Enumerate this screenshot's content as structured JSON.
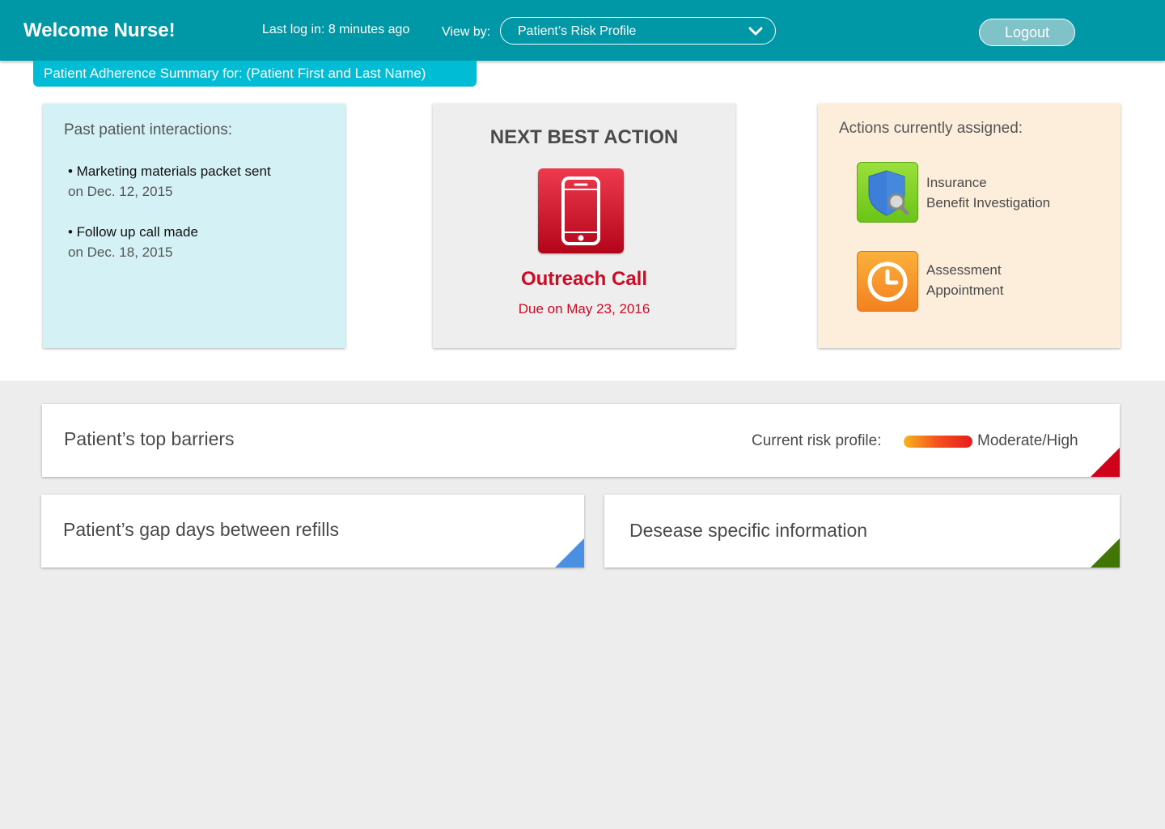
{
  "header": {
    "welcome": "Welcome Nurse!",
    "last_login": "Last log in: 8 minutes ago",
    "view_by_label": "View by:",
    "view_by_value": "Patient’s Risk Profile",
    "logout_label": "Logout"
  },
  "summary": {
    "title": "Patient Adherence Summary for: (Patient First and Last Name)"
  },
  "past_interactions": {
    "heading": "Past patient interactions:",
    "items": [
      {
        "what": "• Marketing materials packet sent",
        "when": "on Dec. 12, 2015"
      },
      {
        "what": "• Follow up call made",
        "when": "on Dec. 18, 2015"
      }
    ]
  },
  "next_best_action": {
    "heading": "NEXT BEST ACTION",
    "icon": "smartphone-icon",
    "action": "Outreach Call",
    "due": "Due on May 23, 2016"
  },
  "actions_assigned": {
    "heading": "Actions currently assigned:",
    "items": [
      {
        "icon": "shield-search-icon",
        "line1": "Insurance",
        "line2": "Benefit Investigation"
      },
      {
        "icon": "clock-icon",
        "line1": "Assessment",
        "line2": "Appointment"
      }
    ]
  },
  "panels": {
    "barriers": {
      "title": "Patient’s top barriers",
      "risk_label": "Current risk profile:",
      "risk_value": "Moderate/High",
      "corner_color": "#d0021b"
    },
    "gap_days": {
      "title": "Patient’s gap days between refills",
      "corner_color": "#4a90e2"
    },
    "disease": {
      "title": "Desease specific information",
      "corner_color": "#417505"
    }
  },
  "colors": {
    "header": "#0097a7",
    "tab": "#00bcd4",
    "accent_red": "#cf0a22"
  }
}
